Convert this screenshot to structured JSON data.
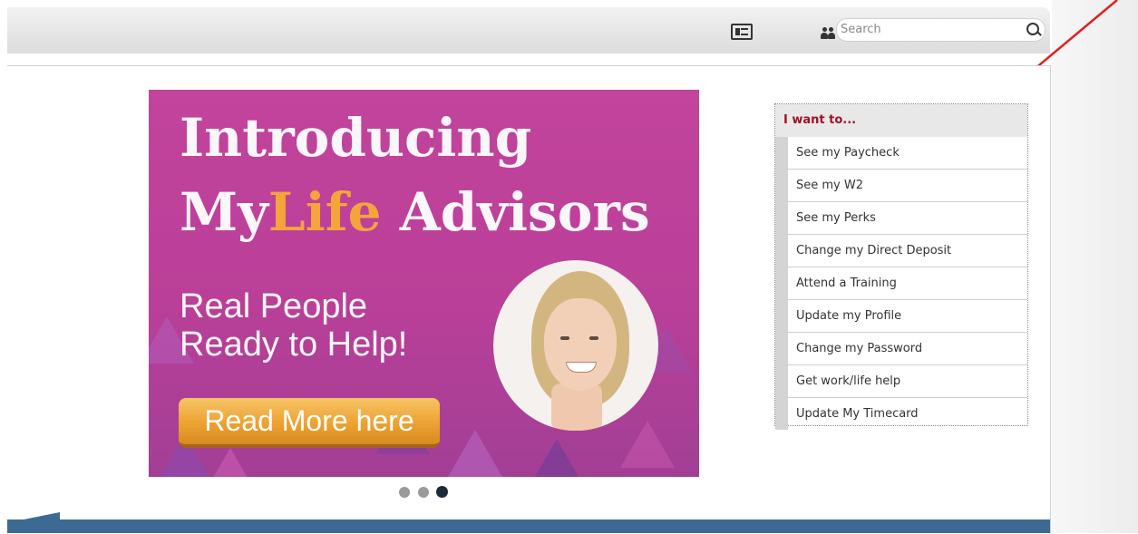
{
  "header": {
    "search": {
      "placeholder": "Search"
    },
    "icons": [
      "contact-card-icon",
      "people-icon",
      "search-icon"
    ]
  },
  "banner": {
    "title_line1": "Introducing",
    "title_my": "My",
    "title_life": "Life",
    "title_advisors": " Advisors",
    "subtitle_line1": "Real People",
    "subtitle_line2": "Ready to Help!",
    "cta_label": "Read More here",
    "accent_color": "#f3a53c",
    "background_color": "#c2449c"
  },
  "carousel": {
    "slides": 3,
    "active_index": 3
  },
  "want_panel": {
    "heading": "I want to...",
    "items": [
      "See my Paycheck",
      "See my W2",
      "See my Perks",
      "Change my Direct Deposit",
      "Attend a Training",
      "Update my Profile",
      "Change my Password",
      "Get work/life help",
      "Update My Timecard"
    ]
  },
  "colors": {
    "heading_red": "#9e1228",
    "annotation_arrow": "#e02020",
    "footer_band": "#3d6a92"
  }
}
